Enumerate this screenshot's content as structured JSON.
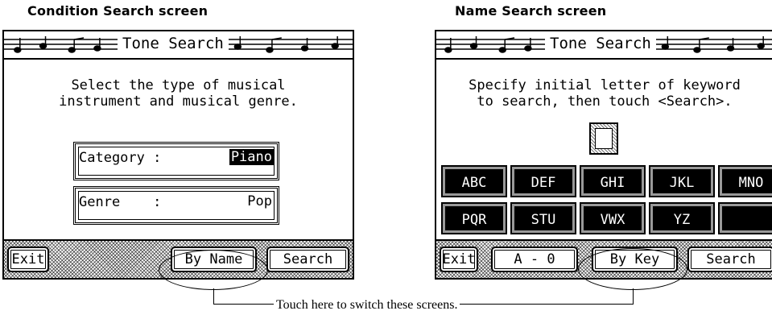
{
  "left": {
    "caption": "Condition Search screen",
    "title": "Tone Search",
    "instruction": "Select the type of musical\ninstrument and musical genre.",
    "fields": [
      {
        "label": "Category :",
        "value": "Piano"
      },
      {
        "label": "Genre    :",
        "value": "Pop"
      }
    ],
    "buttons": {
      "exit": "Exit",
      "by_name": "By Name",
      "search": "Search"
    }
  },
  "right": {
    "caption": "Name Search screen",
    "title": "Tone Search",
    "instruction": "Specify initial letter of keyword\nto search, then touch <Search>.",
    "keys": [
      "ABC",
      "DEF",
      "GHI",
      "JKL",
      "MNO",
      "PQR",
      "STU",
      "VWX",
      "YZ",
      ""
    ],
    "buttons": {
      "exit": "Exit",
      "range": "A - 0",
      "by_key": "By Key",
      "search": "Search"
    }
  },
  "bottom_caption": "Touch here to switch these screens."
}
